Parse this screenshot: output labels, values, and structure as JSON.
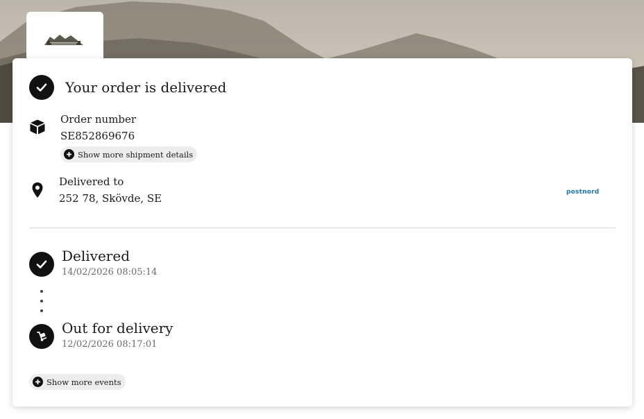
{
  "header": {
    "logo_icon": "brand-logo",
    "colors": {
      "accent": "#111111",
      "carrier": "#1a73b8"
    }
  },
  "status": {
    "headline": "Your order is delivered",
    "icon": "check-circle-icon"
  },
  "order": {
    "label": "Order number",
    "number": "SE852869676",
    "details_button": "Show more shipment details",
    "icon": "package-icon"
  },
  "delivery": {
    "label": "Delivered to",
    "address": "252 78, Skövde, SE",
    "icon": "location-pin-icon",
    "carrier": "postnord"
  },
  "events": [
    {
      "title": "Delivered",
      "time": "14/02/2026 08:05:14",
      "icon": "check-circle-icon"
    },
    {
      "title": "Out for delivery",
      "time": "12/02/2026 08:17:01",
      "icon": "hand-truck-icon"
    }
  ],
  "more_events_button": "Show more events"
}
